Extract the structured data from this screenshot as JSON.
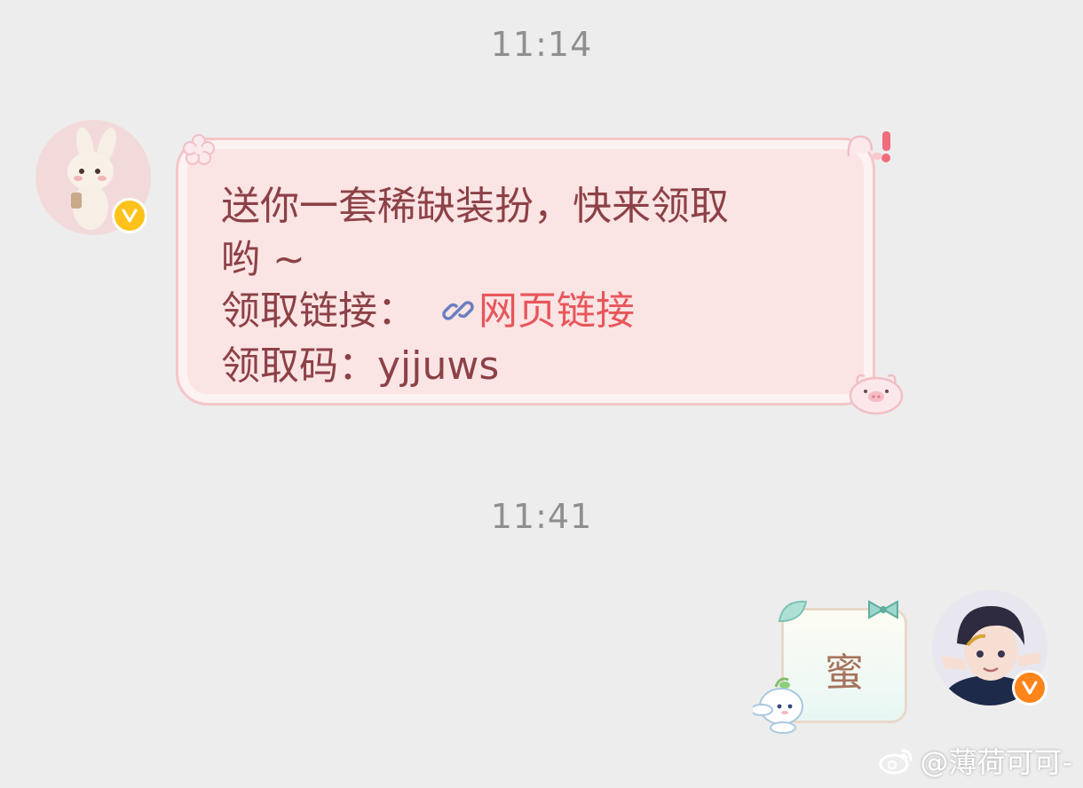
{
  "chat": {
    "messages": [
      {
        "timestamp": "11:14",
        "sender": "left",
        "lines": [
          "送你一套稀缺装扮，快来领取",
          "哟 ~"
        ],
        "link_label": "领取链接：",
        "link_text": "网页链接",
        "code_label": "领取码：",
        "code_value": "yjjuws"
      },
      {
        "timestamp": "11:41",
        "sender": "right",
        "text": "蜜"
      }
    ]
  },
  "watermark": {
    "text": "@薄荷可可-"
  },
  "colors": {
    "background": "#ededed",
    "timestamp": "#8f8f8f",
    "bubble_left_fill": "#fbe4e4",
    "bubble_left_text": "#8c4146",
    "link": "#e8565a",
    "vip_badge_left": "#ffc21a",
    "vip_badge_right": "#ff8419"
  }
}
